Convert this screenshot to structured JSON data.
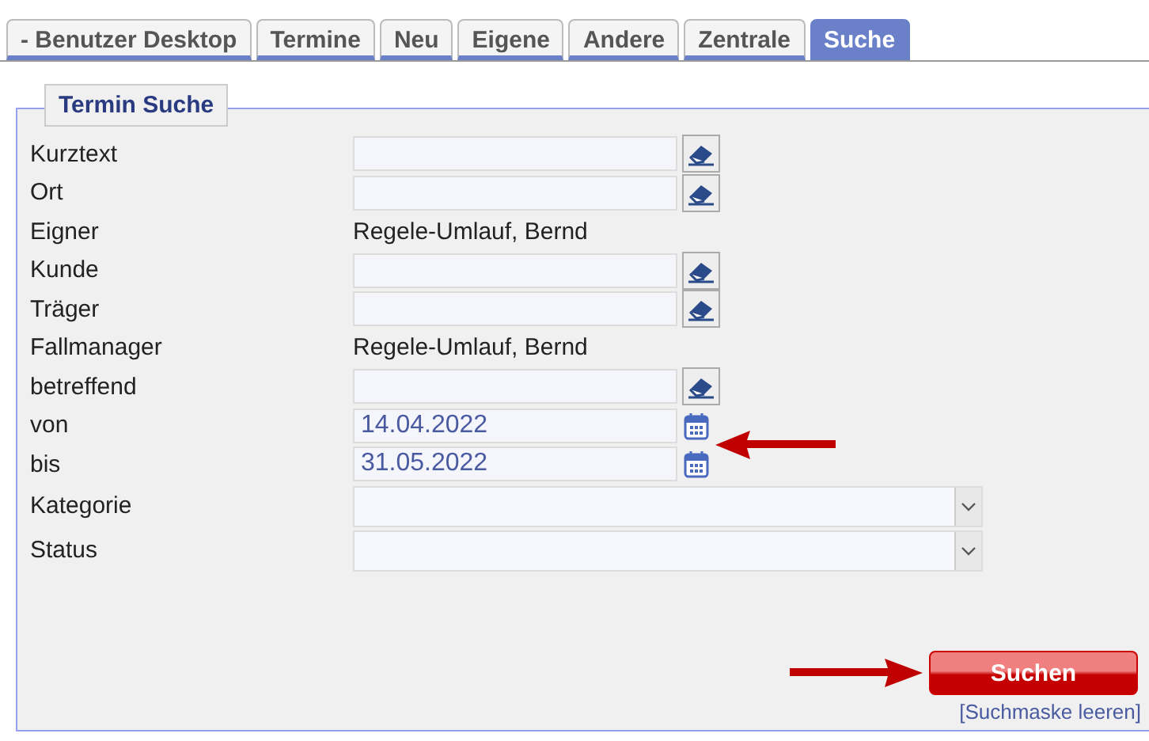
{
  "tabs": [
    {
      "label": "- Benutzer Desktop",
      "selected": false
    },
    {
      "label": "Termine",
      "selected": false
    },
    {
      "label": "Neu",
      "selected": false
    },
    {
      "label": "Eigene",
      "selected": false
    },
    {
      "label": "Andere",
      "selected": false
    },
    {
      "label": "Zentrale",
      "selected": false
    },
    {
      "label": "Suche",
      "selected": true
    }
  ],
  "panel": {
    "legend": "Termin Suche",
    "fields": [
      {
        "label": "Kurztext",
        "kind": "text"
      },
      {
        "label": "Ort",
        "kind": "text"
      },
      {
        "label": "Eigner",
        "kind": "static",
        "value": "Regele-Umlauf, Bernd"
      },
      {
        "label": "Kunde",
        "kind": "text"
      },
      {
        "label": "Träger",
        "kind": "text"
      },
      {
        "label": "Fallmanager",
        "kind": "static",
        "value": "Regele-Umlauf, Bernd"
      },
      {
        "label": "betreffend",
        "kind": "text"
      },
      {
        "label": "von",
        "kind": "date",
        "value": "14.04.2022"
      },
      {
        "label": "bis",
        "kind": "date",
        "value": "31.05.2022"
      },
      {
        "label": "Kategorie",
        "kind": "select"
      },
      {
        "label": "Status",
        "kind": "select"
      }
    ],
    "search_button": "Suchen",
    "clear_link": "[Suchmaske leeren]"
  }
}
